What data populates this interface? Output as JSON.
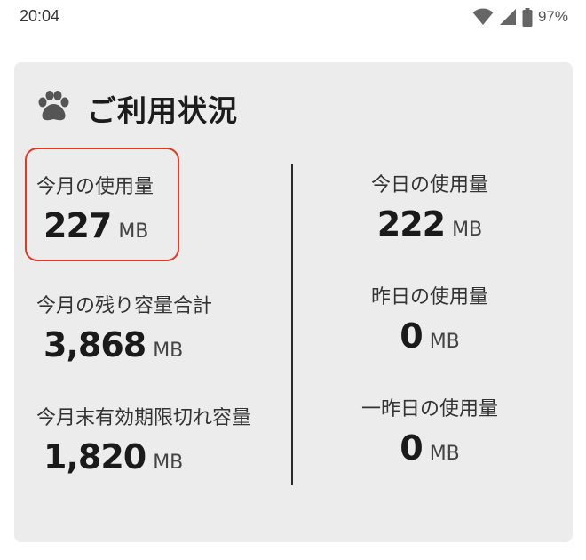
{
  "status_bar": {
    "time": "20:04",
    "battery_percent": "97%",
    "icons": [
      "wifi-icon",
      "signal-icon",
      "battery-icon"
    ]
  },
  "card": {
    "title": "ご利用状況",
    "icon": "paw-icon",
    "left": [
      {
        "label": "今月の使用量",
        "value": "227",
        "unit": "MB"
      },
      {
        "label": "今月の残り容量合計",
        "value": "3,868",
        "unit": "MB"
      },
      {
        "label": "今月末有効期限切れ容量",
        "value": "1,820",
        "unit": "MB"
      }
    ],
    "right": [
      {
        "label": "今日の使用量",
        "value": "222",
        "unit": "MB"
      },
      {
        "label": "昨日の使用量",
        "value": "0",
        "unit": "MB"
      },
      {
        "label": "一昨日の使用量",
        "value": "0",
        "unit": "MB"
      }
    ]
  },
  "colors": {
    "card_background": "#ececec",
    "highlight_border": "#e03a22"
  }
}
